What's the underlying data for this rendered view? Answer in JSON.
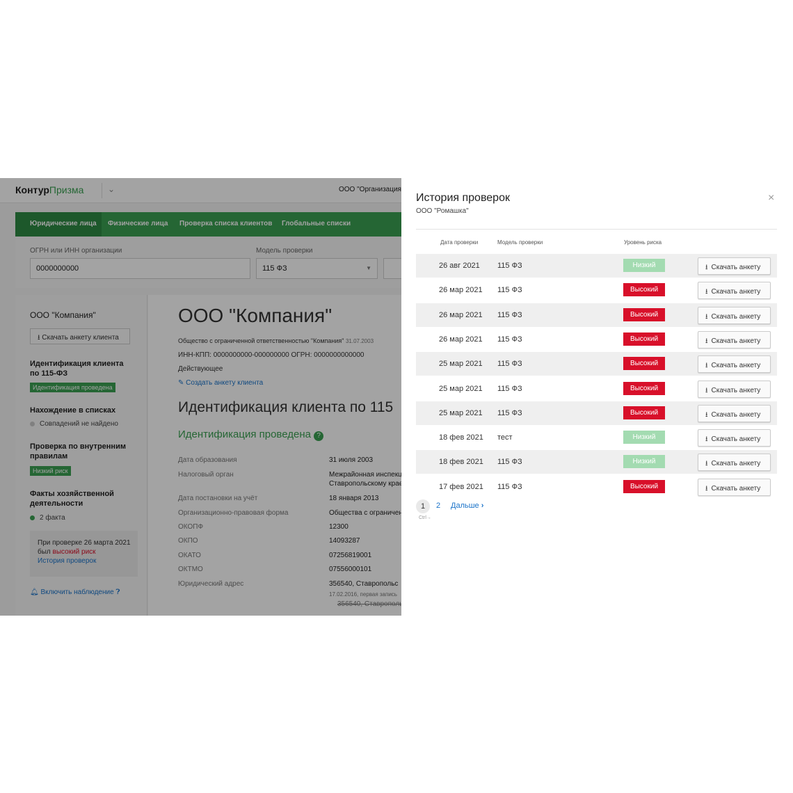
{
  "app": {
    "logo_main": "Контур",
    "logo_sub": "Призма",
    "org": "ООО \"Организация\"",
    "nav": [
      "Юридические лица",
      "Физические лица",
      "Проверка списка клиентов",
      "Глобальные списки"
    ],
    "search": {
      "ogrn_label": "ОГРН или ИНН организации",
      "ogrn_value": "0000000000",
      "model_label": "Модель проверки",
      "model_value": "115 ФЗ"
    },
    "left": {
      "company": "ООО \"Компания\"",
      "download_btn": "Скачать анкету клиента",
      "ident_title": "Идентификация клиента по 115-ФЗ",
      "ident_title_l1": "Идентификация клиента",
      "ident_title_l2": "по 115-ФЗ",
      "ident_badge": "Идентификация проведена",
      "lists_title": "Нахождение в списках",
      "lists_value": "Совпадений не найдено",
      "rules_title_l1": "Проверка по внутренним",
      "rules_title_l2": "правилам",
      "rules_badge": "Низкий риск",
      "facts_title_l1": "Факты хозяйственной",
      "facts_title_l2": "деятельности",
      "facts_value": "2 факта",
      "note_l1": "При проверке 26 марта 2021",
      "note_l2a": "был ",
      "note_l2b": "высокий риск",
      "note_link": "История проверок",
      "watch": "Включить наблюдение"
    },
    "main": {
      "title": "ООО \"Компания\"",
      "desc": "Общество с ограниченной ответственностью \"Компания\"",
      "desc_date": "31.07.2003",
      "inn": "ИНН-КПП: 0000000000-000000000 ОГРН: 0000000000000",
      "status": "Действующее",
      "create_link": "Создать анкету клиента",
      "section_title": "Идентификация клиента по 115",
      "ident_done": "Идентификация проведена",
      "details": [
        {
          "k": "Дата образования",
          "v": "31 июля 2003"
        },
        {
          "k": "Налоговый орган",
          "v": "Межрайонная инспекц"
        },
        {
          "k": "",
          "v": "Ставропольскому крає"
        },
        {
          "k": "Дата постановки на учёт",
          "v": "18 января 2013"
        },
        {
          "k": "Организационно-правовая форма",
          "v": "Общества с ограничен"
        },
        {
          "k": "ОКОПФ",
          "v": "12300"
        },
        {
          "k": "ОКПО",
          "v": "14093287"
        },
        {
          "k": "ОКАТО",
          "v": "07256819001"
        },
        {
          "k": "ОКТМО",
          "v": "07556000101"
        },
        {
          "k": "Юридический адрес",
          "v": "356540, Ставропольс"
        }
      ],
      "addr_note": "17.02.2016, первая запись",
      "addr_old": "356540, Ставрополь"
    }
  },
  "modal": {
    "title": "История проверок",
    "subtitle": "ООО \"Ромашка\"",
    "close": "×",
    "headers": {
      "date": "Дата проверки",
      "model": "Модель проверки",
      "risk": "Уровень риска"
    },
    "download_label": "Скачать анкету",
    "rows": [
      {
        "date": "26 авг 2021",
        "model": "115 ФЗ",
        "risk": "Низкий",
        "level": "low"
      },
      {
        "date": "26 мар 2021",
        "model": "115 ФЗ",
        "risk": "Высокий",
        "level": "high"
      },
      {
        "date": "26 мар 2021",
        "model": "115 ФЗ",
        "risk": "Высокий",
        "level": "high"
      },
      {
        "date": "26 мар 2021",
        "model": "115 ФЗ",
        "risk": "Высокий",
        "level": "high"
      },
      {
        "date": "25 мар 2021",
        "model": "115 ФЗ",
        "risk": "Высокий",
        "level": "high"
      },
      {
        "date": "25 мар 2021",
        "model": "115 ФЗ",
        "risk": "Высокий",
        "level": "high"
      },
      {
        "date": "25 мар 2021",
        "model": "115 ФЗ",
        "risk": "Высокий",
        "level": "high"
      },
      {
        "date": "18 фев 2021",
        "model": "тест",
        "risk": "Низкий",
        "level": "low"
      },
      {
        "date": "18 фев 2021",
        "model": "115 ФЗ",
        "risk": "Низкий",
        "level": "low"
      },
      {
        "date": "17 фев 2021",
        "model": "115 ФЗ",
        "risk": "Высокий",
        "level": "high"
      }
    ],
    "pager": {
      "current": "1",
      "next_page": "2",
      "next_label": "Дальше",
      "hint": "Ctrl→"
    }
  },
  "colors": {
    "brand_green": "#3aa052",
    "risk_high": "#d8102a",
    "risk_low": "#a3dbb1",
    "link": "#1a73c9"
  },
  "icons": [
    "chevron-down-icon",
    "download-icon",
    "pencil-icon",
    "help-icon",
    "bell-icon",
    "close-icon",
    "chevron-right-icon"
  ]
}
